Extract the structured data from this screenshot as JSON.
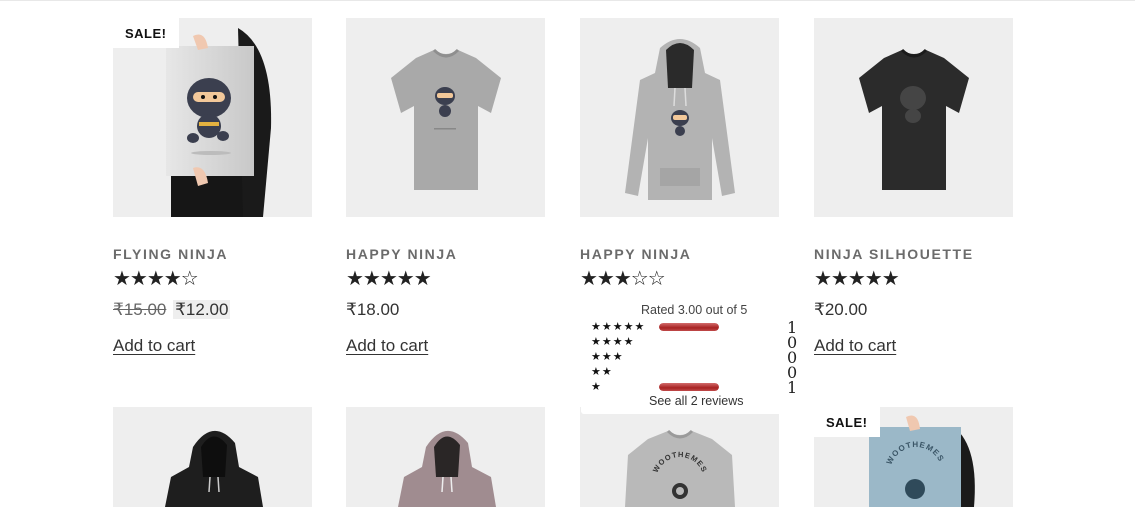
{
  "products": [
    {
      "title": "Flying Ninja",
      "sale_badge": "SALE!",
      "stars": "★★★★☆",
      "price_old": "₹15.00",
      "price_new": "₹12.00",
      "cart": "Add to cart"
    },
    {
      "title": "Happy Ninja",
      "stars": "★★★★★",
      "price": "₹18.00",
      "cart": "Add to cart"
    },
    {
      "title": "Happy Ninja",
      "stars": "★★★☆☆",
      "price": "",
      "cart": ""
    },
    {
      "title": "Ninja Silhouette",
      "stars": "★★★★★",
      "price": "₹20.00",
      "cart": "Add to cart"
    }
  ],
  "bottom_row": [
    {
      "image": "black-hoodie"
    },
    {
      "image": "pink-hoodie"
    },
    {
      "image": "woothemes-sweatshirt",
      "print_text": "WOOTHEMES"
    },
    {
      "image": "woothemes-poster",
      "sale_badge": "SALE!",
      "print_text": "WOOTHEMES"
    }
  ],
  "rating_popup": {
    "title": "Rated 3.00 out of 5",
    "rows": [
      {
        "stars": "★★★★★",
        "count": "1",
        "fill": 1.0
      },
      {
        "stars": "★★★★",
        "count": "0",
        "fill": 0.0
      },
      {
        "stars": "★★★",
        "count": "0",
        "fill": 0.0
      },
      {
        "stars": "★★",
        "count": "0",
        "fill": 0.0
      },
      {
        "stars": "★",
        "count": "1",
        "fill": 1.0
      }
    ],
    "link": "See all 2 reviews"
  },
  "colors": {
    "thumb_bg": "#eeeeee",
    "bar": "#b22a2a",
    "title": "#6b6b6b"
  }
}
